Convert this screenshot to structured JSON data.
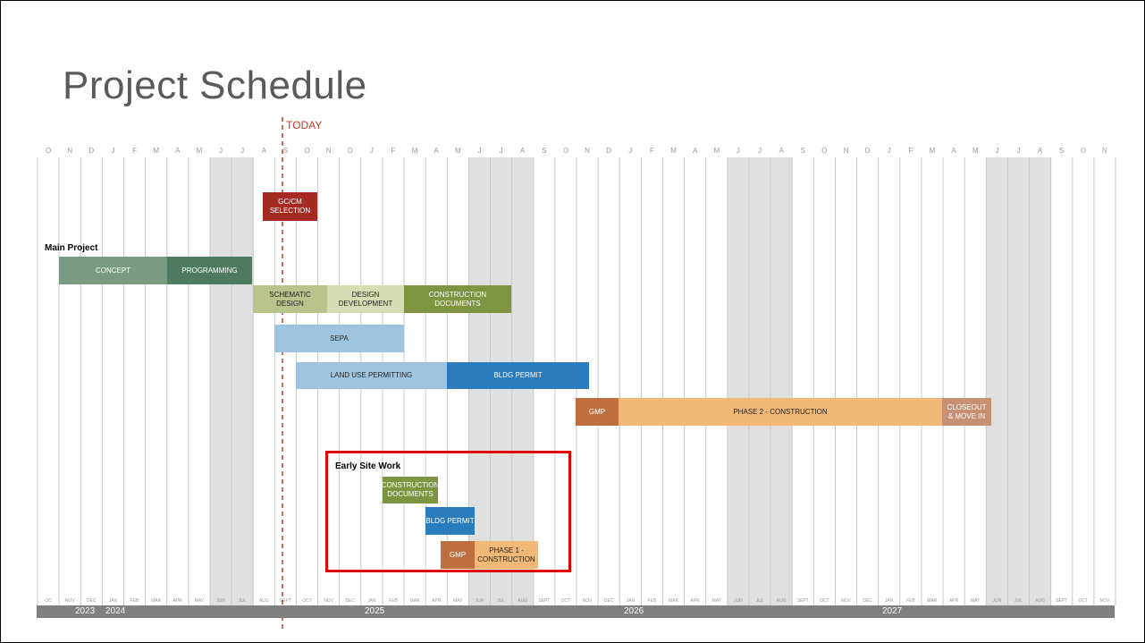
{
  "title": "Project Schedule",
  "today_label": "TODAY",
  "month_initials": [
    "O",
    "N",
    "D",
    "J",
    "F",
    "M",
    "A",
    "M",
    "J",
    "J",
    "A",
    "S",
    "O",
    "N",
    "D",
    "J",
    "F",
    "M",
    "A",
    "M",
    "J",
    "J",
    "A",
    "S",
    "O",
    "N",
    "D",
    "J",
    "F",
    "M",
    "A",
    "M",
    "J",
    "J",
    "A",
    "S",
    "O",
    "N",
    "D",
    "J",
    "F",
    "M",
    "A",
    "M",
    "J",
    "J",
    "A",
    "S",
    "O",
    "N"
  ],
  "month_abbrevs": [
    "OC",
    "NOV",
    "DEC",
    "JAN",
    "FEB",
    "MAR",
    "APR",
    "MAY",
    "JUN",
    "JUL",
    "AUG",
    "SEPT",
    "OCT",
    "NOV",
    "DEC",
    "JAN",
    "FEB",
    "MAR",
    "APR",
    "MAY",
    "JUN",
    "JUL",
    "AUG",
    "SEPT",
    "OCT",
    "NOV",
    "DEC",
    "JAN",
    "FEB",
    "MAR",
    "APR",
    "MAY",
    "JUN",
    "JUL",
    "AUG",
    "SEPT",
    "OCT",
    "NOV",
    "DEC",
    "JAN",
    "FEB",
    "MAR",
    "APR",
    "MAY",
    "JUN",
    "JUL",
    "AUG",
    "SEPT",
    "OCT",
    "NOV"
  ],
  "years": [
    "2023",
    "2024",
    "2025",
    "2026",
    "2027"
  ],
  "sections": {
    "main_project": "Main Project",
    "early_site_work": "Early Site Work"
  },
  "tasks": {
    "gc_cm": [
      "GC/CM",
      "SELECTION"
    ],
    "concept": [
      "CONCEPT"
    ],
    "programming": [
      "PROGRAMMING"
    ],
    "schematic": [
      "SCHEMATIC",
      "DESIGN"
    ],
    "design_dev": [
      "DESIGN",
      "DEVELOPMENT"
    ],
    "construction_docs": [
      "CONSTRUCTION",
      "DOCUMENTS"
    ],
    "sepa": [
      "SEPA"
    ],
    "land_use": [
      "LAND USE PERMITTING"
    ],
    "bldg_permit": [
      "BLDG PERMIT"
    ],
    "gmp": [
      "GMP"
    ],
    "phase2": [
      "PHASE 2 - CONSTRUCTION"
    ],
    "closeout": [
      "CLOSEOUT",
      "& MOVE IN"
    ],
    "esw_construction_docs": [
      "CONSTRUCTION",
      "DOCUMENTS"
    ],
    "esw_bldg_permit": [
      "BLDG PERMIT"
    ],
    "esw_gmp": [
      "GMP"
    ],
    "esw_phase1": [
      "PHASE 1 -",
      "CONSTRUCTION"
    ]
  },
  "colors": {
    "gc_cm": "#a52a22",
    "concept": "#7a9a82",
    "programming": "#4e7a62",
    "schematic": "#b9c48d",
    "design_dev": "#d6dcb4",
    "construction_docs": "#7f9440",
    "sepa": "#9fc4e0",
    "land_use": "#9fc4e0",
    "bldg_permit": "#2a7cbc",
    "gmp": "#c0703e",
    "phase2": "#f2b877",
    "closeout": "#c69072",
    "today_line": "#c0392b",
    "highlight": "#e00000",
    "shade": "#e0e0e0",
    "year_bar": "#7f7f7f"
  }
}
